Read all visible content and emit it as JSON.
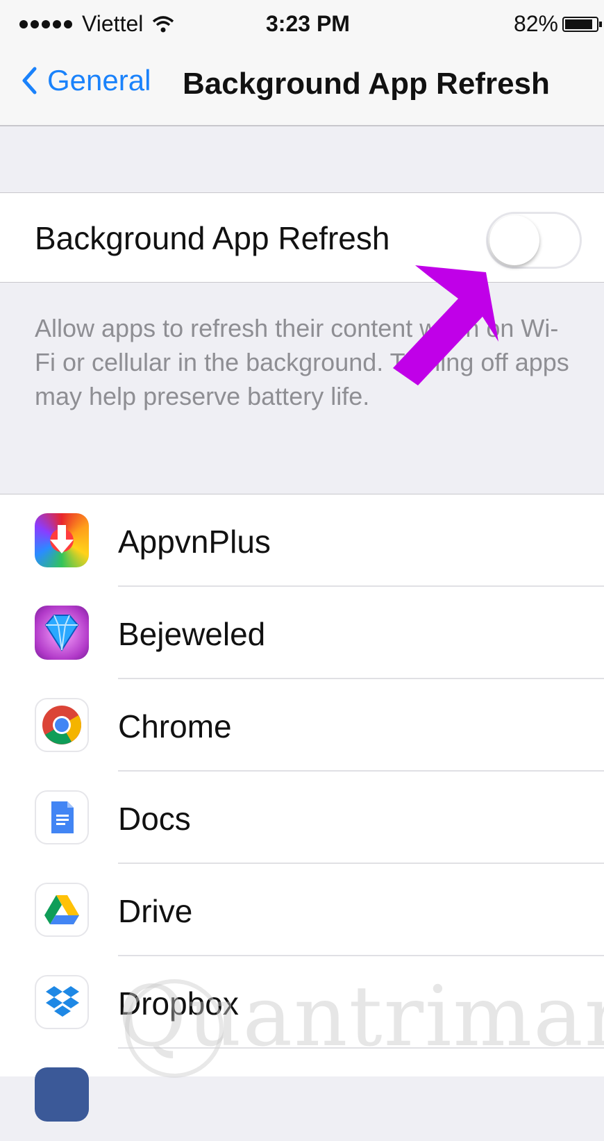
{
  "status_bar": {
    "carrier": "Viettel",
    "time": "3:23 PM",
    "battery": "82%"
  },
  "nav": {
    "back_label": "General",
    "title": "Background App Refresh"
  },
  "toggle": {
    "label": "Background App Refresh",
    "enabled": false
  },
  "description": "Allow apps to refresh their content when on Wi-Fi or cellular in the background. Turning off apps may help preserve battery life.",
  "apps": [
    {
      "name": "AppvnPlus",
      "icon": "appvnplus-icon"
    },
    {
      "name": "Bejeweled",
      "icon": "bejeweled-icon"
    },
    {
      "name": "Chrome",
      "icon": "chrome-icon"
    },
    {
      "name": "Docs",
      "icon": "docs-icon"
    },
    {
      "name": "Drive",
      "icon": "drive-icon"
    },
    {
      "name": "Dropbox",
      "icon": "dropbox-icon"
    }
  ],
  "watermark": "Quantrimang",
  "colors": {
    "accent": "#1a82fb",
    "annotation_arrow": "#c000e8"
  }
}
